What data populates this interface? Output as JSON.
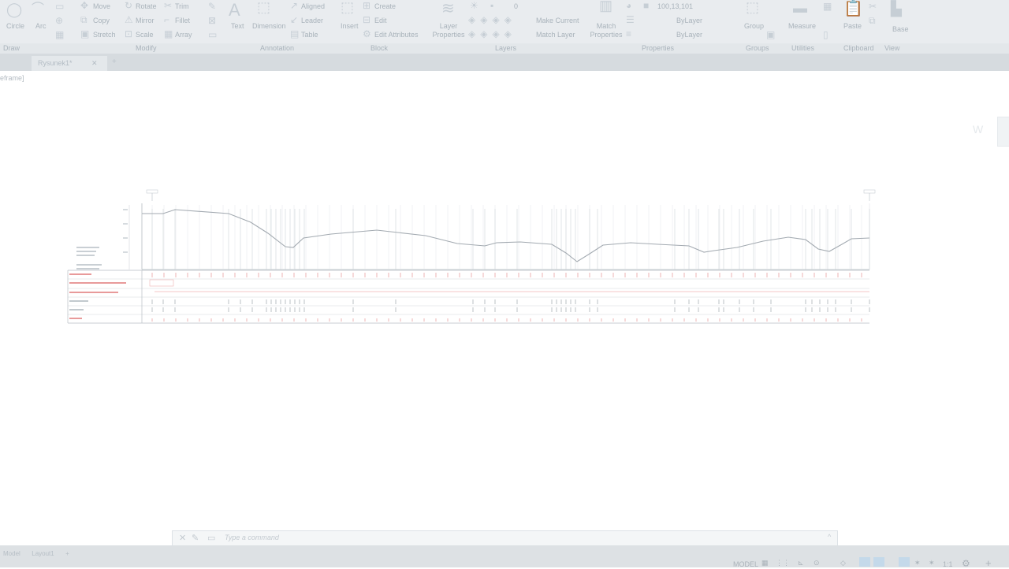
{
  "ribbon": {
    "tools": {
      "circle": "Circle",
      "arc": "Arc",
      "move": "Move",
      "copy": "Copy",
      "stretch": "Stretch",
      "rotate": "Rotate",
      "mirror": "Mirror",
      "scale": "Scale",
      "trim": "Trim",
      "fillet": "Fillet",
      "array": "Array",
      "text": "Text",
      "dimension": "Dimension",
      "aligned": "Aligned",
      "leader": "Leader",
      "table": "Table",
      "insert": "Insert",
      "create": "Create",
      "edit": "Edit",
      "edit_attributes": "Edit Attributes",
      "layer_properties": "Layer Properties",
      "make_current": "Make Current",
      "match_layer": "Match Layer",
      "match_properties": "Match Properties",
      "group": "Group",
      "measure": "Measure",
      "paste": "Paste",
      "base": "Base"
    },
    "layer_value": "0",
    "color_value": "100,13,101",
    "linetype_value": "ByLayer",
    "lineweight_value": "ByLayer",
    "panels": {
      "draw": "Draw",
      "modify": "Modify",
      "annotation": "Annotation",
      "block": "Block",
      "layers": "Layers",
      "properties": "Properties",
      "groups": "Groups",
      "utilities": "Utilities",
      "clipboard": "Clipboard",
      "view": "View"
    }
  },
  "tabs": {
    "document": "Rysunek1*"
  },
  "canvas": {
    "view_label": "eframe]"
  },
  "drawing": {
    "rows": [
      "",
      "",
      "",
      "",
      "",
      ""
    ]
  },
  "command": {
    "placeholder": "Type a command"
  },
  "status": {
    "layout_tabs": [
      "Model",
      "Layout1",
      "+"
    ],
    "model": "MODEL",
    "scale": "1:1"
  },
  "colors": {
    "ribbon_bg": "#e9ecef",
    "accent_red": "#e06060",
    "profile": "#9aa3ab"
  },
  "icons": [
    "circle-icon",
    "arc-icon",
    "move-icon",
    "rotate-icon",
    "trim-icon",
    "text-icon",
    "gear-icon",
    "plus-icon"
  ]
}
